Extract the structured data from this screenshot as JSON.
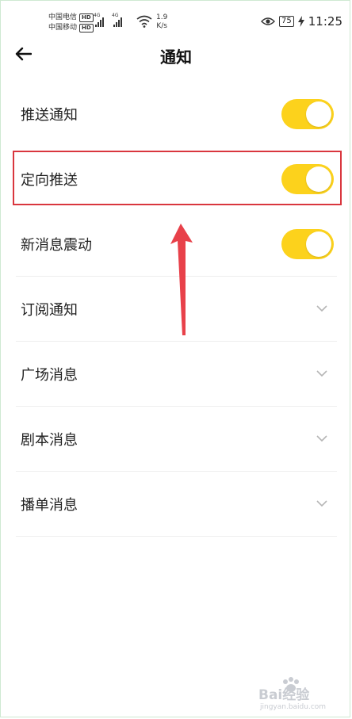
{
  "status_bar": {
    "carrier1": "中国电信",
    "carrier2": "中国移动",
    "hd": "HD",
    "net1": "4G",
    "net2": "4G",
    "speed_value": "1.9",
    "speed_unit": "K/s",
    "battery": "75",
    "time": "11:25"
  },
  "header": {
    "title": "通知"
  },
  "settings": {
    "push": {
      "label": "推送通知",
      "on": true
    },
    "targeted": {
      "label": "定向推送",
      "on": true
    },
    "vibrate": {
      "label": "新消息震动",
      "on": true
    },
    "subscribe": {
      "label": "订阅通知"
    },
    "plaza": {
      "label": "广场消息"
    },
    "script": {
      "label": "剧本消息"
    },
    "playlist": {
      "label": "播单消息"
    }
  },
  "watermark": {
    "brand": "Bai经验",
    "url": "jingyan.baidu.com"
  },
  "colors": {
    "toggle_on": "#fcd21c",
    "highlight": "#d9363e",
    "arrow": "#e8414a"
  }
}
